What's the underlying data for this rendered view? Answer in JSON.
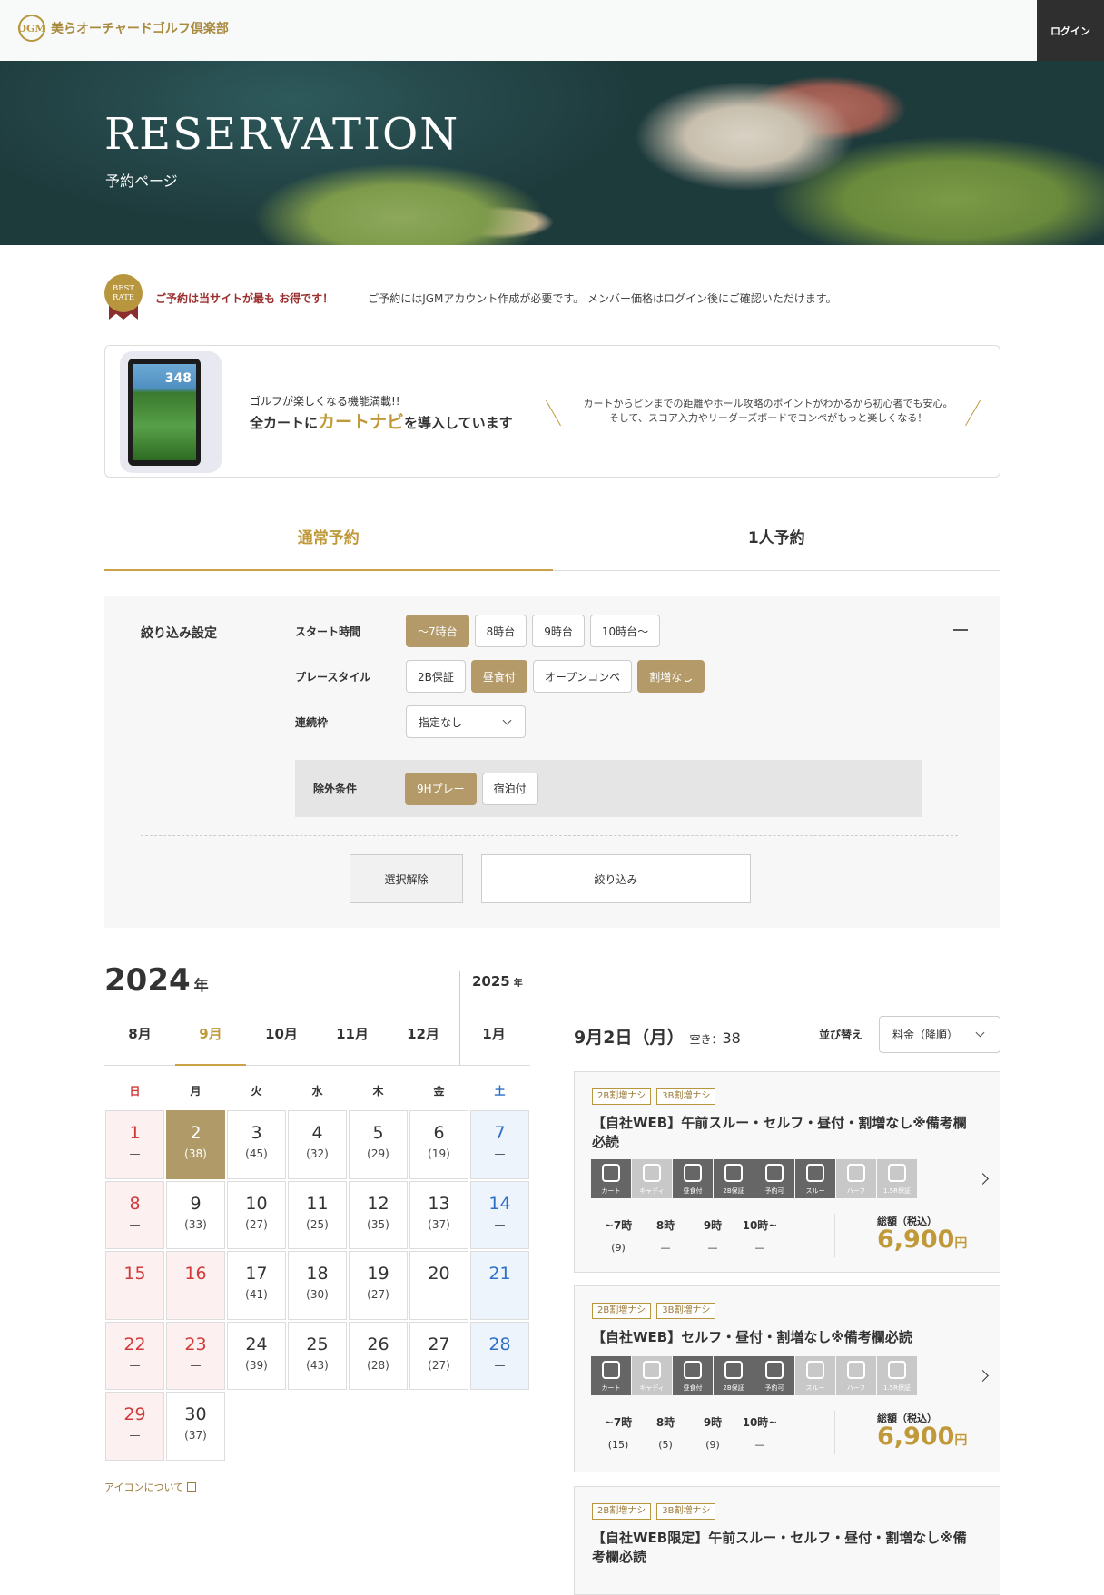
{
  "header": {
    "logo_mark": "OGM",
    "logo_text": "美らオーチャードゴルフ倶楽部",
    "login_label": "ログイン"
  },
  "hero": {
    "title": "RESERVATION",
    "subtitle": "予約ページ"
  },
  "notice": {
    "badge_line1": "BEST",
    "badge_line2": "RATE",
    "highlight": "ご予約は当サイトが最も お得です！",
    "text": "ご予約にはJGMアカウント作成が必要です。 メンバー価格はログイン後にご確認いただけます。"
  },
  "banner": {
    "device_number": "348",
    "small": "ゴルフが楽しくなる機能満載!!",
    "big_pre": "全カートに",
    "big_highlight": "カートナビ",
    "big_post": "を導入しています",
    "desc_line1": "カートからピンまでの距離やホール攻略のポイントがわかるから初心者でも安心。",
    "desc_line2": "そして、スコア入力やリーダーズボードでコンペがもっと楽しくなる！"
  },
  "tabs": [
    {
      "label": "通常予約",
      "active": true
    },
    {
      "label": "1人予約",
      "active": false
    }
  ],
  "filter": {
    "title": "絞り込み設定",
    "start_time": {
      "label": "スタート時間",
      "options": [
        {
          "label": "〜7時台",
          "on": true
        },
        {
          "label": "8時台",
          "on": false
        },
        {
          "label": "9時台",
          "on": false
        },
        {
          "label": "10時台〜",
          "on": false
        }
      ]
    },
    "play_style": {
      "label": "プレースタイル",
      "options": [
        {
          "label": "2B保証",
          "on": false
        },
        {
          "label": "昼食付",
          "on": true
        },
        {
          "label": "オープンコンペ",
          "on": false
        },
        {
          "label": "割増なし",
          "on": true
        }
      ]
    },
    "consecutive": {
      "label": "連続枠",
      "value": "指定なし"
    },
    "exclude": {
      "label": "除外条件",
      "options": [
        {
          "label": "9Hプレー",
          "on": true
        },
        {
          "label": "宿泊付",
          "on": false
        }
      ]
    },
    "clear_label": "選択解除",
    "apply_label": "絞り込み"
  },
  "calendar": {
    "year1": "2024",
    "year2": "2025",
    "year_suffix": "年",
    "months": [
      {
        "label": "8月",
        "active": false
      },
      {
        "label": "9月",
        "active": true
      },
      {
        "label": "10月",
        "active": false
      },
      {
        "label": "11月",
        "active": false
      },
      {
        "label": "12月",
        "active": false
      },
      {
        "label": "1月",
        "active": false
      }
    ],
    "weekdays": [
      "日",
      "月",
      "火",
      "水",
      "木",
      "金",
      "土"
    ],
    "days": [
      {
        "d": "1",
        "c": "—",
        "t": "sun"
      },
      {
        "d": "2",
        "c": "(38)",
        "t": "sel"
      },
      {
        "d": "3",
        "c": "(45)",
        "t": ""
      },
      {
        "d": "4",
        "c": "(32)",
        "t": ""
      },
      {
        "d": "5",
        "c": "(29)",
        "t": ""
      },
      {
        "d": "6",
        "c": "(19)",
        "t": ""
      },
      {
        "d": "7",
        "c": "—",
        "t": "sat"
      },
      {
        "d": "8",
        "c": "—",
        "t": "sun"
      },
      {
        "d": "9",
        "c": "(33)",
        "t": ""
      },
      {
        "d": "10",
        "c": "(27)",
        "t": ""
      },
      {
        "d": "11",
        "c": "(25)",
        "t": ""
      },
      {
        "d": "12",
        "c": "(35)",
        "t": ""
      },
      {
        "d": "13",
        "c": "(37)",
        "t": ""
      },
      {
        "d": "14",
        "c": "—",
        "t": "sat"
      },
      {
        "d": "15",
        "c": "—",
        "t": "sun"
      },
      {
        "d": "16",
        "c": "—",
        "t": "sun"
      },
      {
        "d": "17",
        "c": "(41)",
        "t": ""
      },
      {
        "d": "18",
        "c": "(30)",
        "t": ""
      },
      {
        "d": "19",
        "c": "(27)",
        "t": ""
      },
      {
        "d": "20",
        "c": "—",
        "t": ""
      },
      {
        "d": "21",
        "c": "—",
        "t": "sat"
      },
      {
        "d": "22",
        "c": "—",
        "t": "sun"
      },
      {
        "d": "23",
        "c": "—",
        "t": "sun"
      },
      {
        "d": "24",
        "c": "(39)",
        "t": ""
      },
      {
        "d": "25",
        "c": "(43)",
        "t": ""
      },
      {
        "d": "26",
        "c": "(28)",
        "t": ""
      },
      {
        "d": "27",
        "c": "(27)",
        "t": ""
      },
      {
        "d": "28",
        "c": "—",
        "t": "sat"
      },
      {
        "d": "29",
        "c": "—",
        "t": "sun"
      },
      {
        "d": "30",
        "c": "(37)",
        "t": ""
      }
    ],
    "icon_note": "アイコンについて"
  },
  "day": {
    "title": "9月2日（月）",
    "avail_label": "空き：",
    "avail_count": "38",
    "sort_label": "並び替え",
    "sort_value": "料金（降順）"
  },
  "plans": [
    {
      "tags": [
        "2B割増ナシ",
        "3B割増ナシ"
      ],
      "name": "【自社WEB】午前スルー・セルフ・昼付・割増なし※備考欄必読",
      "icons": [
        {
          "label": "カート",
          "on": true
        },
        {
          "label": "キャディ",
          "on": false
        },
        {
          "label": "昼食付",
          "on": true
        },
        {
          "label": "2B保証",
          "on": true
        },
        {
          "label": "予約可",
          "on": true
        },
        {
          "label": "スルー",
          "on": true
        },
        {
          "label": "ハーフ",
          "on": false
        },
        {
          "label": "1.5R保証",
          "on": false
        }
      ],
      "slots": [
        {
          "t": "~7時",
          "c": "(9)"
        },
        {
          "t": "8時",
          "c": "—"
        },
        {
          "t": "9時",
          "c": "—"
        },
        {
          "t": "10時~",
          "c": "—"
        }
      ],
      "price_label": "総額（税込）",
      "price": "6,900",
      "yen": "円"
    },
    {
      "tags": [
        "2B割増ナシ",
        "3B割増ナシ"
      ],
      "name": "【自社WEB】セルフ・昼付・割増なし※備考欄必読",
      "icons": [
        {
          "label": "カート",
          "on": true
        },
        {
          "label": "キャディ",
          "on": false
        },
        {
          "label": "昼食付",
          "on": true
        },
        {
          "label": "2B保証",
          "on": true
        },
        {
          "label": "予約可",
          "on": true
        },
        {
          "label": "スルー",
          "on": false
        },
        {
          "label": "ハーフ",
          "on": false
        },
        {
          "label": "1.5R保証",
          "on": false
        }
      ],
      "slots": [
        {
          "t": "~7時",
          "c": "(15)"
        },
        {
          "t": "8時",
          "c": "(5)"
        },
        {
          "t": "9時",
          "c": "(9)"
        },
        {
          "t": "10時~",
          "c": "—"
        }
      ],
      "price_label": "総額（税込）",
      "price": "6,900",
      "yen": "円"
    },
    {
      "tags": [
        "2B割増ナシ",
        "3B割増ナシ"
      ],
      "name": "【自社WEB限定】午前スルー・セルフ・昼付・割増なし※備考欄必読"
    }
  ]
}
